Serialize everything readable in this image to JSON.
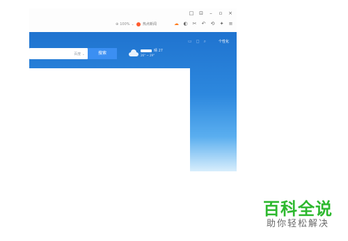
{
  "titlebar": {
    "controls": [
      "□",
      "⊡",
      "–",
      "▫",
      "×"
    ]
  },
  "toolbar": {
    "zoom": "100%",
    "hot_label": "热点新闻",
    "tool_icons": [
      "☁",
      "◐",
      "✂",
      "↶",
      "⟲",
      "✦",
      "≡"
    ]
  },
  "search": {
    "engine_label": "百度",
    "button_label": "搜索"
  },
  "weather": {
    "condition": "晴 27",
    "range": "26° ~ 29°"
  },
  "header": {
    "icons": [
      "▭",
      "◻",
      "⌕"
    ],
    "user_label": "个性化"
  },
  "brand": {
    "title": "百科全说",
    "subtitle": "助你轻松解决"
  }
}
